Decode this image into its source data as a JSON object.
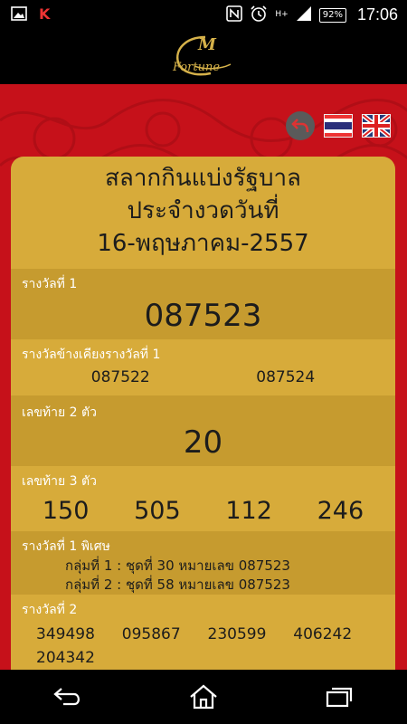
{
  "status": {
    "time": "17:06",
    "battery": "92%",
    "network": "H+",
    "icons": [
      "gallery-icon",
      "k-app-icon",
      "nfc-icon",
      "alarm-icon",
      "signal-icon",
      "battery-icon"
    ]
  },
  "app": {
    "logo_letter": "M",
    "logo_word": "Fortune"
  },
  "colors": {
    "background_red": "#c6111a",
    "card_gold": "#d7ab3a",
    "card_gold_dark": "#c69b2f"
  },
  "title": {
    "line1": "สลากกินแบ่งรัฐบาล",
    "line2": "ประจำงวดวันที่",
    "line3": "16-พฤษภาคม-2557"
  },
  "prize1": {
    "label": "รางวัลที่ 1",
    "number": "087523"
  },
  "adjacent": {
    "label": "รางวัลข้างเคียงรางวัลที่ 1",
    "numbers": [
      "087522",
      "087524"
    ]
  },
  "last2": {
    "label": "เลขท้าย 2 ตัว",
    "number": "20"
  },
  "last3": {
    "label": "เลขท้าย 3 ตัว",
    "numbers": [
      "150",
      "505",
      "112",
      "246"
    ]
  },
  "special": {
    "label": "รางวัลที่ 1 พิเศษ",
    "lines": [
      "กลุ่มที่ 1 : ชุดที่ 30 หมายเลข 087523",
      "กลุ่มที่ 2 : ชุดที่ 58 หมายเลข 087523"
    ]
  },
  "prize2": {
    "label": "รางวัลที่ 2",
    "numbers": [
      "349498",
      "095867",
      "230599",
      "406242",
      "204342"
    ]
  }
}
